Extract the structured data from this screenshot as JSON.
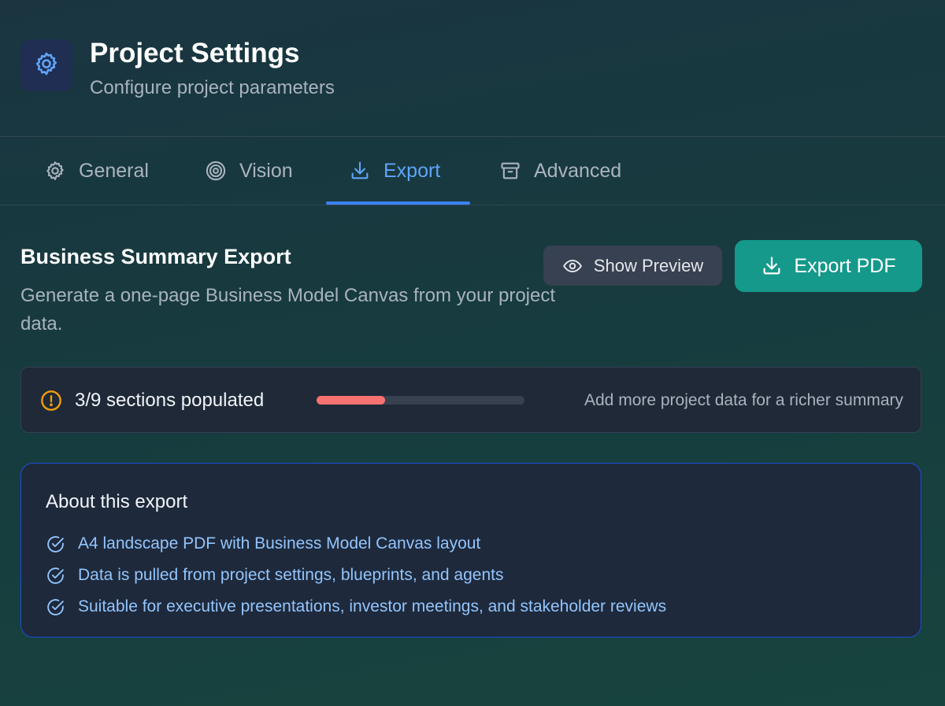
{
  "header": {
    "icon": "gear-icon",
    "title": "Project Settings",
    "subtitle": "Configure project parameters"
  },
  "tabs": [
    {
      "label": "General",
      "icon": "gear-icon",
      "active": false
    },
    {
      "label": "Vision",
      "icon": "target-icon",
      "active": false
    },
    {
      "label": "Export",
      "icon": "download-icon",
      "active": true
    },
    {
      "label": "Advanced",
      "icon": "archive-icon",
      "active": false
    }
  ],
  "export": {
    "title": "Business Summary Export",
    "description": "Generate a one-page Business Model Canvas from your project data.",
    "preview_label": "Show Preview",
    "export_label": "Export PDF"
  },
  "status": {
    "text": "3/9 sections populated",
    "progress": 0.33,
    "hint": "Add more project data for a richer summary",
    "colors": {
      "warning": "#f59e0b",
      "fill": "#f87171"
    }
  },
  "about": {
    "title": "About this export",
    "items": [
      "A4 landscape PDF with Business Model Canvas layout",
      "Data is pulled from project settings, blueprints, and agents",
      "Suitable for executive presentations, investor meetings, and stakeholder reviews"
    ]
  },
  "colors": {
    "accent": "#3b82f6",
    "primary_button": "#14998a"
  }
}
